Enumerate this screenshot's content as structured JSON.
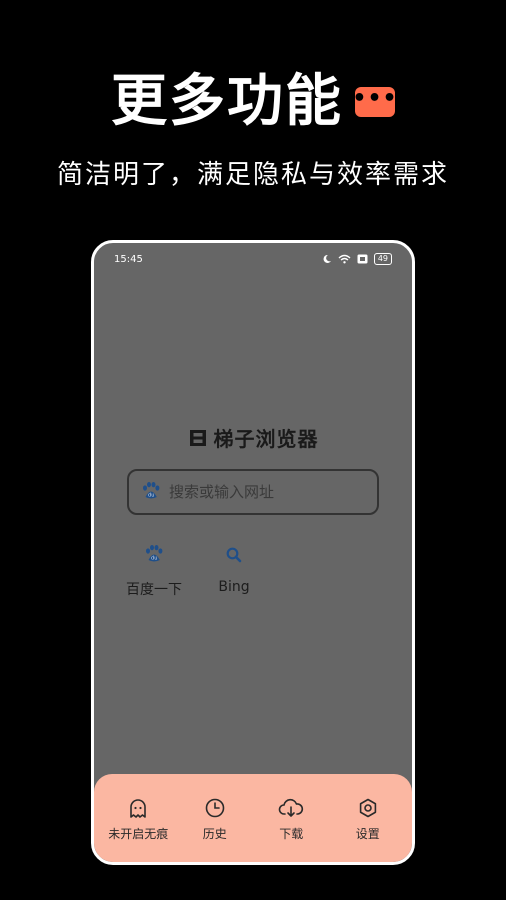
{
  "promo": {
    "title": "更多功能",
    "badge_icon": "more-dots-icon",
    "badge_color": "#ff6b4a",
    "subtitle": "简洁明了，满足隐私与效率需求"
  },
  "status_bar": {
    "time": "15:45",
    "battery": "49",
    "icons": [
      "moon-icon",
      "wifi-icon",
      "sim-icon",
      "battery-icon"
    ]
  },
  "app": {
    "brand_name": "梯子浏览器",
    "logo_icon": "ladder-logo-icon"
  },
  "search": {
    "placeholder": "搜索或输入网址",
    "engine_icon": "baidu-paw-icon"
  },
  "shortcuts": [
    {
      "label": "百度一下",
      "icon": "baidu-paw-icon"
    },
    {
      "label": "Bing",
      "icon": "search-icon"
    }
  ],
  "bottom_nav": [
    {
      "label": "未开启无痕",
      "icon": "ghost-icon"
    },
    {
      "label": "历史",
      "icon": "clock-icon"
    },
    {
      "label": "下载",
      "icon": "cloud-download-icon"
    },
    {
      "label": "设置",
      "icon": "settings-icon"
    }
  ],
  "colors": {
    "background": "#000000",
    "screen_gray": "#666666",
    "bottom_bar": "#fbb7a2",
    "accent": "#ff6b4a",
    "icon_blue": "#1f4f8a"
  }
}
